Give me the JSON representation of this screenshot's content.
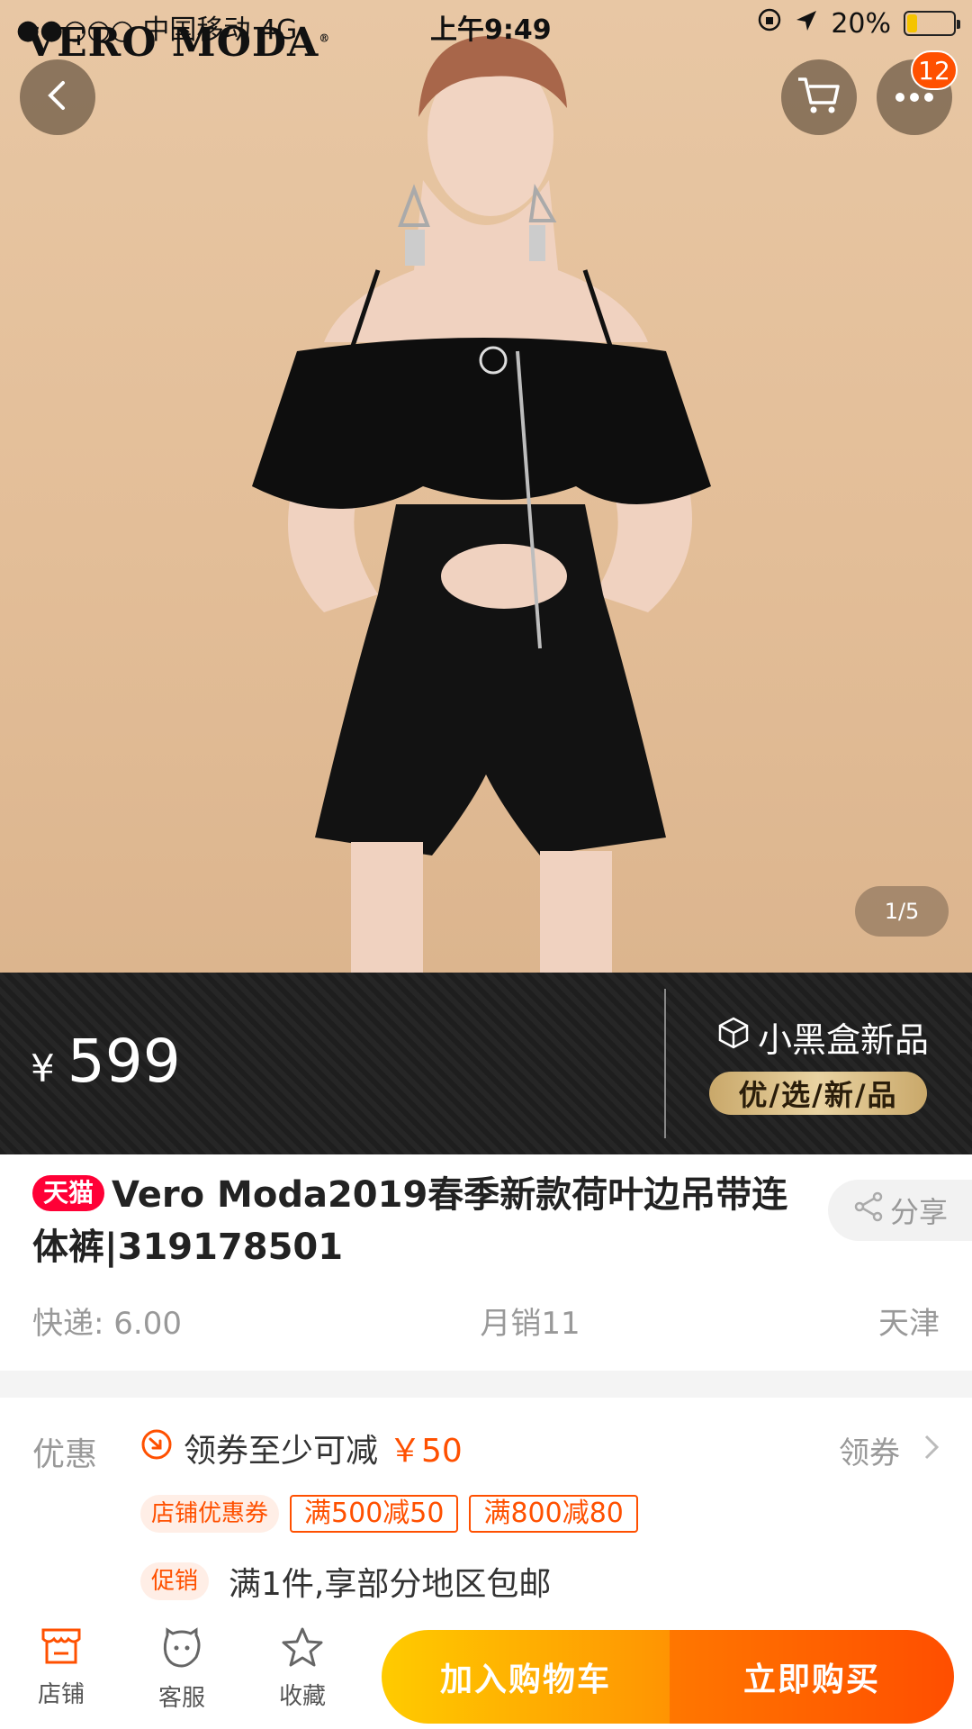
{
  "status_bar": {
    "carrier": "●●○○○ 中国移动  4G",
    "time": "上午9:49",
    "battery": "20%",
    "battery_level": 0.2
  },
  "hero": {
    "brand": "VERO MODA",
    "brand_mark": "®",
    "cart_badge": "12",
    "pager": "1/5"
  },
  "price_banner": {
    "currency": "¥",
    "price": "599",
    "new_tag": "小黑盒新品",
    "tagline": "优/选/新/品"
  },
  "product": {
    "platform_tag": "天猫",
    "title": "Vero Moda2019春季新款荷叶边吊带连体裤|319178501",
    "share": "分享",
    "shipping": "快递: 6.00",
    "monthly_sales": "月销11",
    "location": "天津"
  },
  "promotions": {
    "label": "优惠",
    "coupon_text": "领券至少可减",
    "coupon_amount": "￥50",
    "get_coupon": "领券",
    "shop_coupon_tag": "店铺优惠券",
    "coupons": [
      "满500减50",
      "满800减80"
    ],
    "promo_tag": "促销",
    "promo_text": "满1件,享部分地区包邮"
  },
  "bottom_bar": {
    "shop": "店铺",
    "service": "客服",
    "favorite": "收藏",
    "add_to_cart": "加入购物车",
    "buy_now": "立即购买"
  },
  "colors": {
    "accent": "#ff5000",
    "tmall_red": "#ff0036",
    "cart_gradient": [
      "#ffcb00",
      "#ff9402"
    ],
    "buy_gradient": [
      "#ff7700",
      "#ff4e00"
    ]
  },
  "icons": [
    "back-icon",
    "cart-icon",
    "more-icon",
    "share-icon",
    "coupon-icon",
    "chevron-right-icon",
    "shop-icon",
    "service-icon",
    "star-icon",
    "cube-icon"
  ]
}
